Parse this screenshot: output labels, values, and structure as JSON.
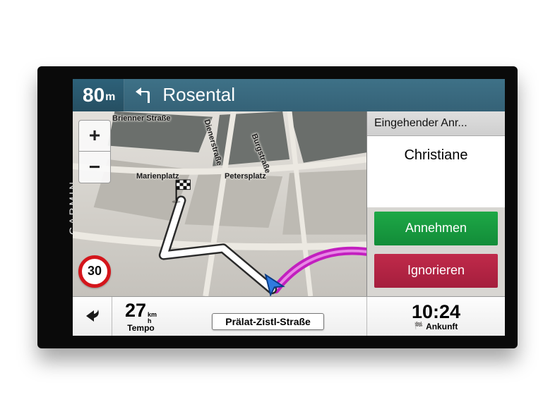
{
  "brand": "GARMIN",
  "nav": {
    "distance_value": "80",
    "distance_unit": "m",
    "next_street": "Rosental",
    "current_street": "Prälat-Zistl-Straße"
  },
  "streets": {
    "brienner": "Brienner Straße",
    "diener": "Dienerstraße",
    "burg": "Burgstraße",
    "marien": "Marienplatz",
    "peters": "Petersplatz"
  },
  "zoom": {
    "in": "+",
    "out": "−"
  },
  "speed_limit": "30",
  "call": {
    "header": "Eingehender Anr...",
    "caller": "Christiane",
    "accept": "Annehmen",
    "ignore": "Ignorieren"
  },
  "status": {
    "speed_value": "27",
    "speed_unit_top": "km",
    "speed_unit_bot": "h",
    "speed_label": "Tempo",
    "arrival_time": "10:24",
    "arrival_label": "Ankunft"
  },
  "colors": {
    "header_bg": "#356277",
    "accept": "#128c38",
    "ignore": "#a51e3d",
    "route": "#ffffff",
    "alt_route": "#c21fbf"
  }
}
